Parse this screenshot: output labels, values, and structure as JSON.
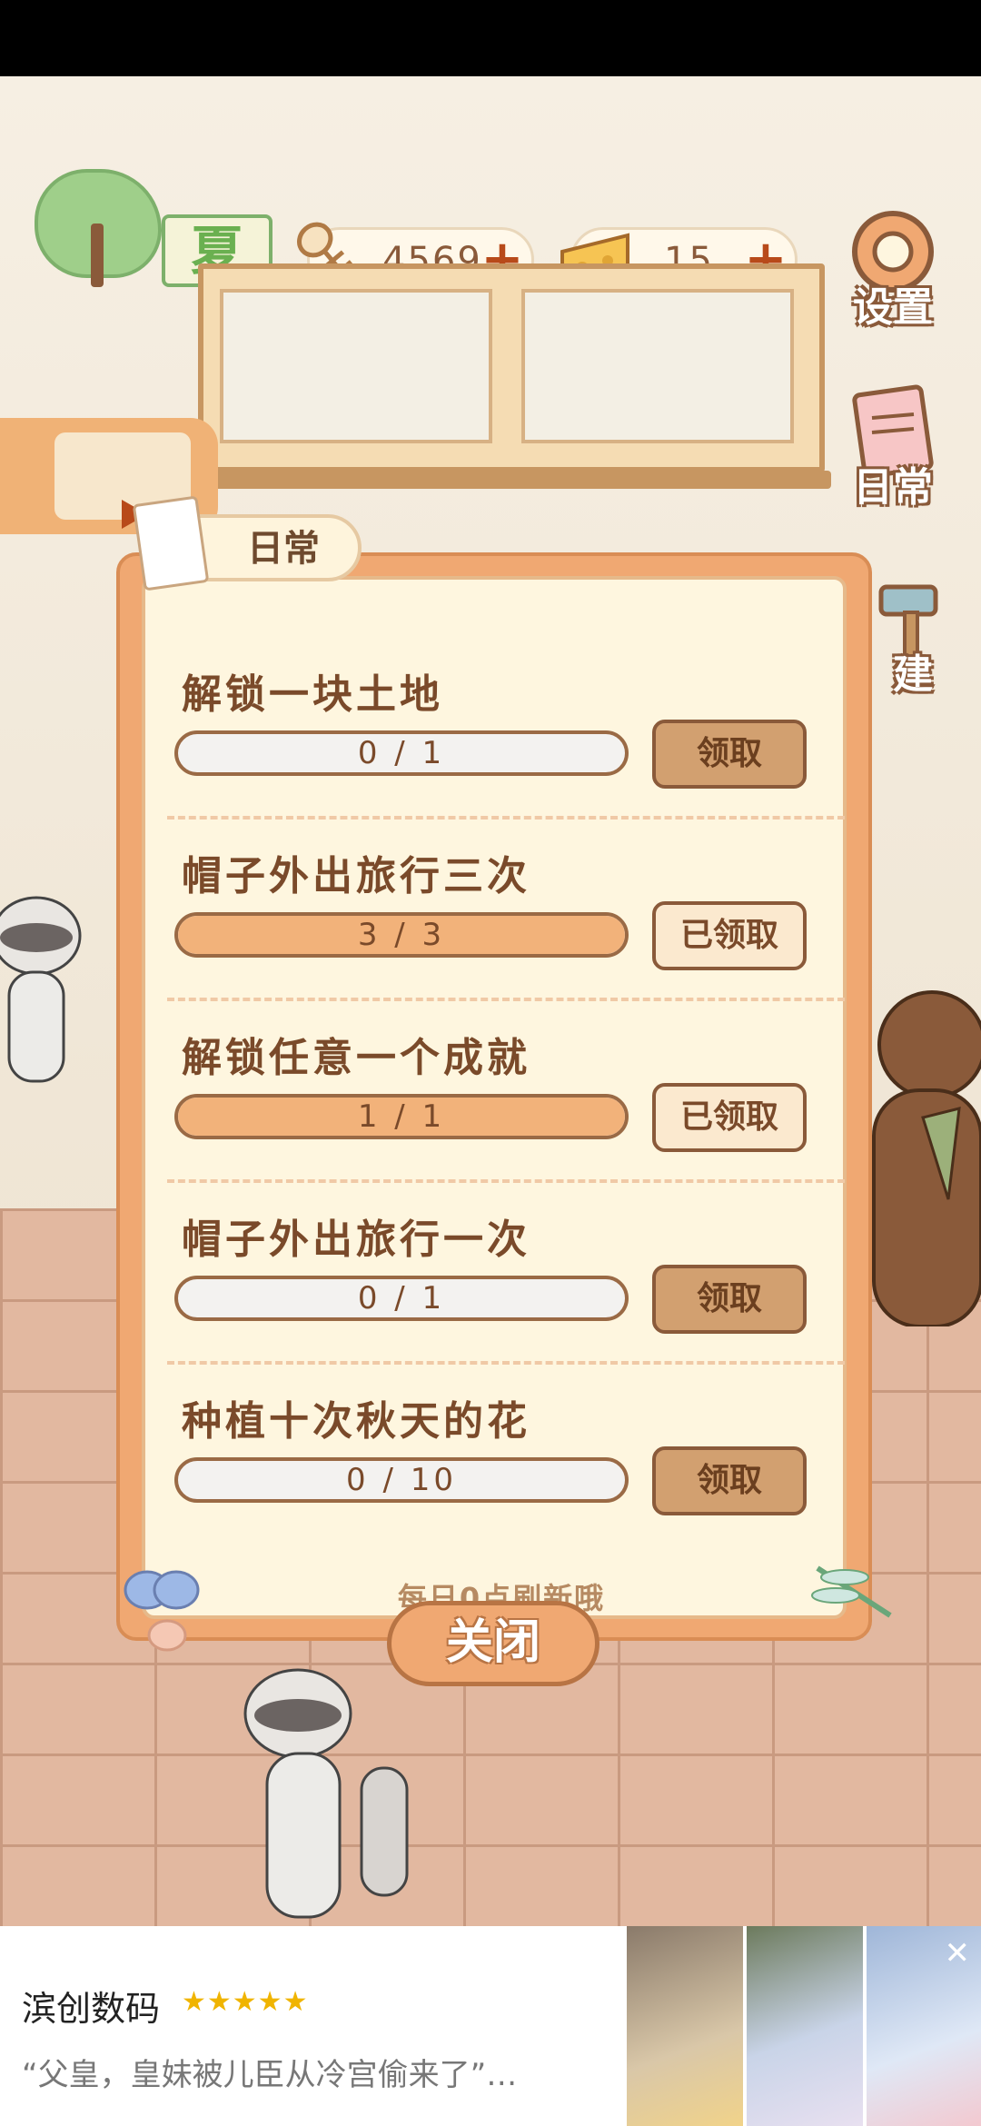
{
  "resources": {
    "fish": "4569",
    "cheese": "15"
  },
  "season": {
    "label": "夏"
  },
  "side_buttons": {
    "settings": "设置",
    "daily": "日常",
    "build": "建"
  },
  "dialog": {
    "tab_title": "日常",
    "tasks": [
      {
        "title": "解锁一块土地",
        "progress_text": "0 / 1",
        "progress": 0.0,
        "button": "领取",
        "claimed": false
      },
      {
        "title": "帽子外出旅行三次",
        "progress_text": "3 / 3",
        "progress": 1.0,
        "button": "已领取",
        "claimed": true
      },
      {
        "title": "解锁任意一个成就",
        "progress_text": "1 / 1",
        "progress": 1.0,
        "button": "已领取",
        "claimed": true
      },
      {
        "title": "帽子外出旅行一次",
        "progress_text": "0 / 1",
        "progress": 0.0,
        "button": "领取",
        "claimed": false
      },
      {
        "title": "种植十次秋天的花",
        "progress_text": "0 / 10",
        "progress": 0.0,
        "button": "领取",
        "claimed": false
      }
    ],
    "refresh_note": "每日0点刷新哦",
    "close_label": "关闭"
  },
  "ad": {
    "app_name": "滨创数码",
    "stars": "★★★★★",
    "description": "“父皇，皇妹被儿臣从冷宫偷来了”…",
    "close": "✕"
  },
  "colors": {
    "dialog_frame": "#f0a872",
    "paper": "#fef6df",
    "text_brown": "#7a4a2a",
    "progress_fill": "#f2b27a",
    "season_green": "#6ab050"
  }
}
